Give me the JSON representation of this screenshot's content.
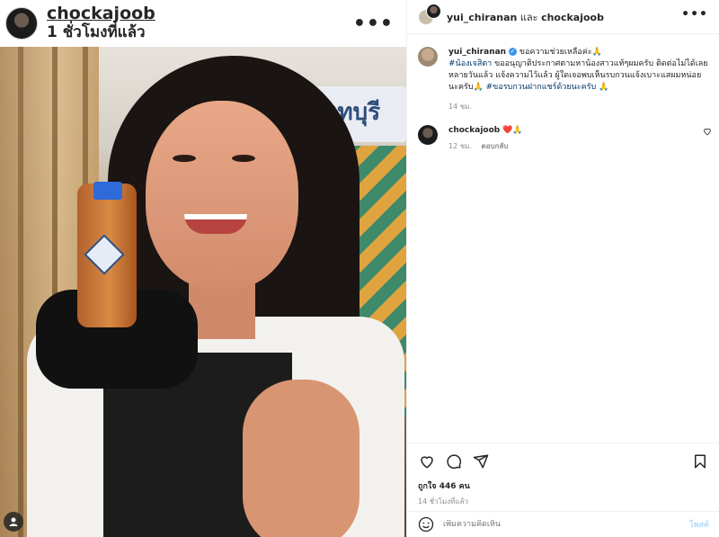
{
  "left": {
    "username": "chockajoob",
    "time_ago": "1 ชั่วโมงที่แล้ว",
    "more": "•••",
    "sign_text": "นนทบุรี"
  },
  "post": {
    "header": {
      "user1": "yui_chiranan",
      "and": " และ ",
      "user2": "chockajoob",
      "more": "•••"
    },
    "caption": {
      "username": "yui_chiranan",
      "intro": " ขอความช่วยเหลือค่ะ🙏",
      "hashtag1": "#น้องเจสิตา",
      "text1": " ขออนุญาติประกาศตามหาน้องสาวแท้ๆผมครับ ติดต่อไม่ได้เลยหลายวันแล้ว แจ้งความไว้แล้ว ผู้ใดเจอพบเห็นรบกวนแจ้งเบาะแสผมหน่อยนะครับ🙏 ",
      "hashtag2": "#ขอรบกวนฝากแชร์ด้วยนะครับ",
      "text2": " 🙏",
      "time": "14 ชม."
    },
    "comment": {
      "username": "chockajoob",
      "text": " ❤️🙏",
      "time": "12 ชม.",
      "reply": "ตอบกลับ"
    },
    "likes": "ถูกใจ 446 คน",
    "posted": "14 ชั่วโมงที่แล้ว",
    "comment_placeholder": "เพิ่มความคิดเห็น",
    "post_button": "โพสต์"
  },
  "icons": {
    "like": "heart-icon",
    "comment": "comment-icon",
    "share": "send-icon",
    "save": "bookmark-icon",
    "emoji": "emoji-icon",
    "tag": "user-tag-icon"
  },
  "colors": {
    "hashtag": "#00376b",
    "verified": "#3897f0",
    "muted": "#8e8e8e",
    "post_button": "#b2dffc"
  }
}
